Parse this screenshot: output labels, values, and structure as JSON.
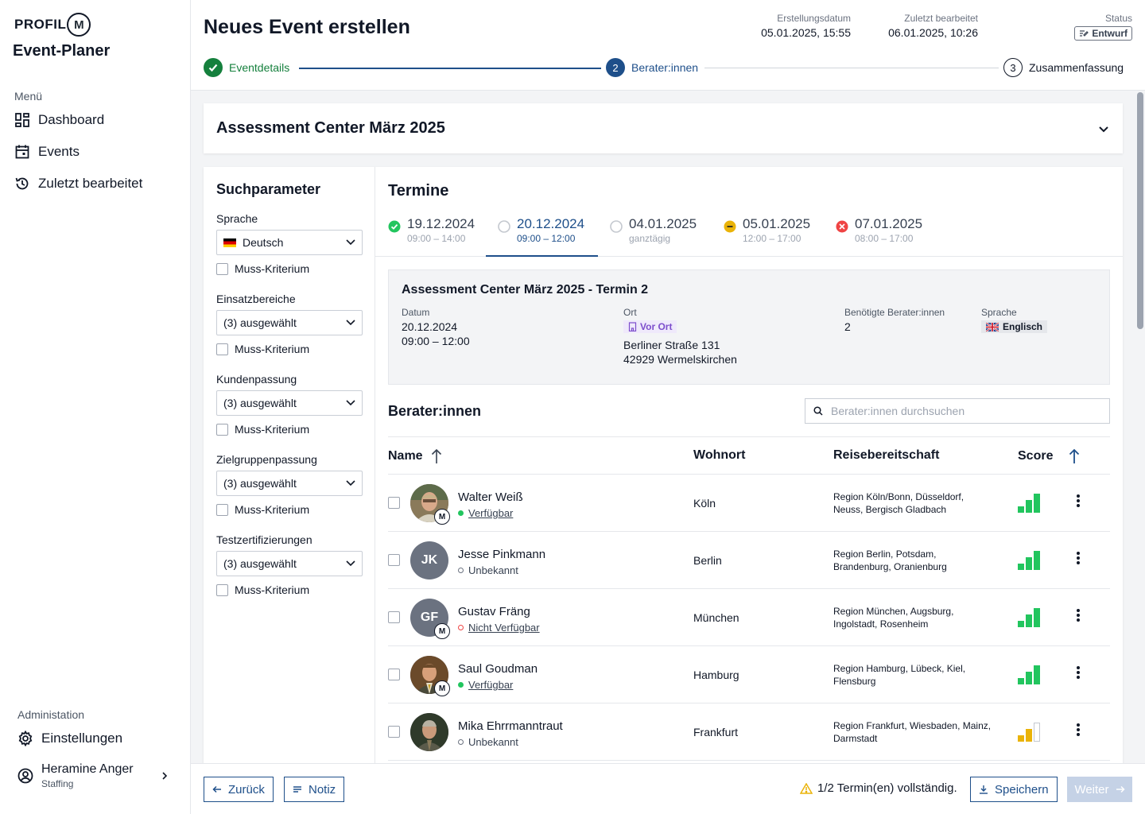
{
  "brand": {
    "logo_text": "PROFIL",
    "logo_letter": "M",
    "app_name": "Event-Planer"
  },
  "sidebar": {
    "menu_label": "Menü",
    "items": [
      {
        "label": "Dashboard",
        "icon": "dashboard-icon"
      },
      {
        "label": "Events",
        "icon": "calendar-icon"
      },
      {
        "label": "Zuletzt bearbeitet",
        "icon": "history-icon"
      }
    ],
    "admin_label": "Administation",
    "settings_label": "Einstellungen",
    "user": {
      "name": "Heramine Anger",
      "role": "Staffing"
    }
  },
  "header": {
    "title": "Neues Event erstellen",
    "created_label": "Erstellungsdatum",
    "created_value": "05.01.2025, 15:55",
    "edited_label": "Zuletzt bearbeitet",
    "edited_value": "06.01.2025, 10:26",
    "status_label": "Status",
    "status_value": "Entwurf"
  },
  "stepper": [
    {
      "number": "1",
      "label": "Eventdetails",
      "state": "done"
    },
    {
      "number": "2",
      "label": "Berater:innen",
      "state": "active"
    },
    {
      "number": "3",
      "label": "Zusammenfassung",
      "state": "todo"
    }
  ],
  "event": {
    "title": "Assessment Center März 2025"
  },
  "filters": {
    "title": "Suchparameter",
    "must_label": "Muss-Kriterium",
    "groups": [
      {
        "label": "Sprache",
        "value": "Deutsch"
      },
      {
        "label": "Einsatzbereiche",
        "value": "(3) ausgewählt"
      },
      {
        "label": "Kundenpassung",
        "value": "(3) ausgewählt"
      },
      {
        "label": "Zielgruppenpassung",
        "value": "(3) ausgewählt"
      },
      {
        "label": "Testzertifizierungen",
        "value": "(3) ausgewählt"
      }
    ]
  },
  "termine": {
    "title": "Termine",
    "tabs": [
      {
        "date": "19.12.2024",
        "time": "09:00 – 14:00",
        "status": "complete",
        "color": "#22c55e"
      },
      {
        "date": "20.12.2024",
        "time": "09:00 – 12:00",
        "status": "open",
        "active": true
      },
      {
        "date": "04.01.2025",
        "time": "ganztägig",
        "status": "open"
      },
      {
        "date": "05.01.2025",
        "time": "12:00 – 17:00",
        "status": "partial",
        "color": "#eab308"
      },
      {
        "date": "07.01.2025",
        "time": "08:00 – 17:00",
        "status": "error",
        "color": "#ef4444"
      }
    ]
  },
  "termin_detail": {
    "title": "Assessment Center März 2025 - Termin 2",
    "date_label": "Datum",
    "date": "20.12.2024",
    "time": "09:00 – 12:00",
    "ort_label": "Ort",
    "ort_badge": "Vor Ort",
    "street": "Berliner Straße 131",
    "city": "42929 Wermelskirchen",
    "needed_label": "Benötigte Berater:innen",
    "needed_value": "2",
    "lang_label": "Sprache",
    "lang_value": "Englisch"
  },
  "berater": {
    "title": "Berater:innen",
    "search_placeholder": "Berater:innen durchsuchen",
    "columns": {
      "name": "Name",
      "wohnort": "Wohnort",
      "reise": "Reisebereitschaft",
      "score": "Score"
    },
    "rows": [
      {
        "name": "Walter Weiß",
        "status": "Verfügbar",
        "status_color": "#22c55e",
        "status_link": true,
        "wohnort": "Köln",
        "reise": "Region Köln/Bonn, Düsseldorf, Neuss, Bergisch Gladbach",
        "score": 3,
        "avatar": "photo",
        "m_badge": true
      },
      {
        "name": "Jesse Pinkmann",
        "initials": "JK",
        "status": "Unbekannt",
        "status_color": "#6b7280",
        "wohnort": "Berlin",
        "reise": "Region Berlin, Potsdam, Brandenburg, Oranienburg",
        "score": 3,
        "avatar": "initials",
        "m_badge": false
      },
      {
        "name": "Gustav Fräng",
        "initials": "GF",
        "status": "Nicht Verfügbar",
        "status_color": "#ef4444",
        "status_link": true,
        "wohnort": "München",
        "reise": "Region München, Augsburg, Ingolstadt, Rosenheim",
        "score": 3,
        "avatar": "initials",
        "m_badge": true
      },
      {
        "name": "Saul Goudman",
        "status": "Verfügbar",
        "status_color": "#22c55e",
        "status_link": true,
        "wohnort": "Hamburg",
        "reise": "Region Hamburg, Lübeck, Kiel, Flensburg",
        "score": 3,
        "avatar": "photo",
        "m_badge": true
      },
      {
        "name": "Mika Ehrrmanntraut",
        "status": "Unbekannt",
        "status_color": "#6b7280",
        "wohnort": "Frankfurt",
        "reise": "Region Frankfurt, Wiesbaden, Mainz, Darmstadt",
        "score": 2,
        "avatar": "photo",
        "m_badge": false
      }
    ]
  },
  "footer": {
    "back": "Zurück",
    "note": "Notiz",
    "warning": "1/2 Termin(en) vollständig.",
    "save": "Speichern",
    "next": "Weiter"
  },
  "colors": {
    "primary": "#1e4f8a",
    "success": "#22c55e",
    "warning": "#eab308",
    "danger": "#ef4444"
  }
}
